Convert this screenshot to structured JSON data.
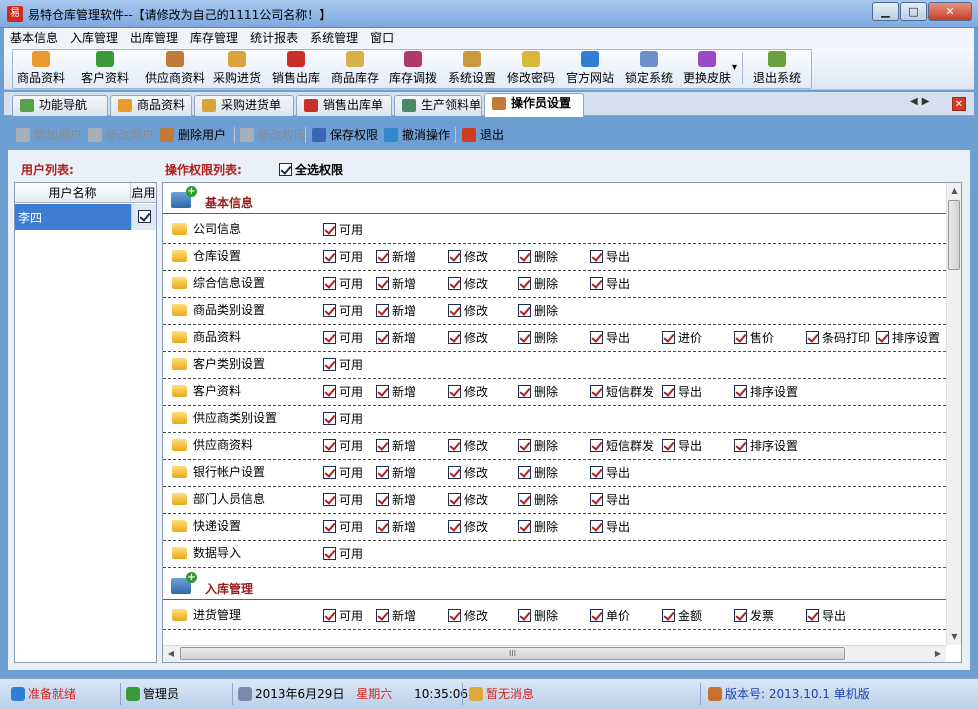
{
  "window": {
    "app_icon_text": "易",
    "title": "易特仓库管理软件--【请修改为自己的1111公司名称！】",
    "min_glyph": "▁",
    "max_glyph": "□",
    "close_glyph": "✕"
  },
  "menu": [
    "基本信息",
    "入库管理",
    "出库管理",
    "库存管理",
    "统计报表",
    "系统管理",
    "窗口"
  ],
  "toolbar": {
    "buttons": [
      {
        "label": "商品资料",
        "icon": "goods-icon",
        "color": "#e89a2c"
      },
      {
        "label": "客户资料",
        "icon": "customers-icon",
        "color": "#3a9a3a"
      },
      {
        "label": "供应商资料",
        "icon": "suppliers-icon",
        "color": "#c07b3a"
      },
      {
        "label": "采购进货",
        "icon": "purchase-truck-icon",
        "color": "#d9a43a"
      },
      {
        "label": "销售出库",
        "icon": "sales-out-icon",
        "color": "#c9302c"
      },
      {
        "label": "商品库存",
        "icon": "inventory-box-icon",
        "color": "#d8b04a"
      },
      {
        "label": "库存调拨",
        "icon": "transfer-icon",
        "color": "#b23a6a"
      },
      {
        "label": "系统设置",
        "icon": "system-settings-icon",
        "color": "#c99a3a"
      },
      {
        "label": "修改密码",
        "icon": "password-pencil-icon",
        "color": "#d7b83a"
      },
      {
        "label": "官方网站",
        "icon": "browser-icon",
        "color": "#2f7fd4"
      },
      {
        "label": "锁定系统",
        "icon": "lock-system-icon",
        "color": "#6a8fc9"
      },
      {
        "label": "更换皮肤",
        "icon": "skin-palette-icon",
        "color": "#9a4ac9"
      },
      {
        "label": "退出系统",
        "icon": "exit-door-icon",
        "color": "#6aa03a"
      }
    ],
    "more_glyph": "▾"
  },
  "tabs": [
    {
      "label": "功能导航",
      "icon": "navigation-icon",
      "color": "#5aa04a",
      "active": false
    },
    {
      "label": "商品资料",
      "icon": "goods-icon",
      "color": "#e89a2c",
      "active": false
    },
    {
      "label": "采购进货单",
      "icon": "purchase-truck-icon",
      "color": "#d9a43a",
      "active": false
    },
    {
      "label": "销售出库单",
      "icon": "sales-out-icon",
      "color": "#c9302c",
      "active": false
    },
    {
      "label": "生产领料单",
      "icon": "production-icon",
      "color": "#4a8a6a",
      "active": false
    },
    {
      "label": "操作员设置",
      "icon": "operators-icon",
      "color": "#c07b3a",
      "active": true
    }
  ],
  "tab_nav": {
    "prev": "◀",
    "next": "▶",
    "close_all": "✕"
  },
  "actions": [
    {
      "label": "增加用户",
      "icon": "add-user-icon",
      "enabled": false,
      "color": "#a9b0ba"
    },
    {
      "label": "修改用户",
      "icon": "edit-user-icon",
      "enabled": false,
      "color": "#a9b0ba"
    },
    {
      "label": "删除用户",
      "icon": "delete-user-icon",
      "enabled": true,
      "color": "#c07b3a"
    },
    {
      "label": "修改权限",
      "icon": "edit-permissions-icon",
      "enabled": false,
      "color": "#a9b0ba"
    },
    {
      "label": "保存权限",
      "icon": "save-icon",
      "enabled": true,
      "color": "#3a66b8"
    },
    {
      "label": "撤消操作",
      "icon": "undo-icon",
      "enabled": true,
      "color": "#2f88c9"
    },
    {
      "label": "退出",
      "icon": "exit-x-icon",
      "enabled": true,
      "color": "#d33a26"
    }
  ],
  "user_list": {
    "label": "用户列表:",
    "columns": [
      "用户名称",
      "启用"
    ],
    "rows": [
      {
        "name": "李四",
        "enabled": true
      }
    ]
  },
  "permissions": {
    "label": "操作权限列表:",
    "select_all_label": "全选权限",
    "select_all_checked": true,
    "sections": [
      {
        "title": "基本信息",
        "rows": [
          {
            "name": "公司信息",
            "options": [
              "可用"
            ]
          },
          {
            "name": "仓库设置",
            "options": [
              "可用",
              "新增",
              "修改",
              "删除",
              "导出"
            ]
          },
          {
            "name": "综合信息设置",
            "options": [
              "可用",
              "新增",
              "修改",
              "删除",
              "导出"
            ]
          },
          {
            "name": "商品类别设置",
            "options": [
              "可用",
              "新增",
              "修改",
              "删除"
            ]
          },
          {
            "name": "商品资料",
            "options": [
              "可用",
              "新增",
              "修改",
              "删除",
              "导出",
              "进价",
              "售价",
              "条码打印",
              "排序设置"
            ]
          },
          {
            "name": "客户类别设置",
            "options": [
              "可用"
            ]
          },
          {
            "name": "客户资料",
            "options": [
              "可用",
              "新增",
              "修改",
              "删除",
              "短信群发",
              "导出",
              "排序设置"
            ]
          },
          {
            "name": "供应商类别设置",
            "options": [
              "可用"
            ]
          },
          {
            "name": "供应商资料",
            "options": [
              "可用",
              "新增",
              "修改",
              "删除",
              "短信群发",
              "导出",
              "排序设置"
            ]
          },
          {
            "name": "银行帐户设置",
            "options": [
              "可用",
              "新增",
              "修改",
              "删除",
              "导出"
            ]
          },
          {
            "name": "部门人员信息",
            "options": [
              "可用",
              "新增",
              "修改",
              "删除",
              "导出"
            ]
          },
          {
            "name": "快递设置",
            "options": [
              "可用",
              "新增",
              "修改",
              "删除",
              "导出"
            ]
          },
          {
            "name": "数据导入",
            "options": [
              "可用"
            ]
          }
        ]
      },
      {
        "title": "入库管理",
        "rows": [
          {
            "name": "进货管理",
            "options": [
              "可用",
              "新增",
              "修改",
              "删除",
              "单价",
              "金额",
              "发票",
              "导出"
            ]
          }
        ]
      }
    ]
  },
  "scrollbar": {
    "up": "▲",
    "down": "▼",
    "left": "◀",
    "right": "▶",
    "grip": "III"
  },
  "status": {
    "ready": "准备就绪",
    "ready_color": "#d4261c",
    "user": "管理员",
    "date": "2013年6月29日",
    "weekday": "星期六",
    "weekday_color": "#d4261c",
    "time": "10:35:06",
    "message": "暂无消息",
    "message_color": "#d4261c",
    "version": "版本号: 2013.10.1 单机版",
    "version_color": "#1d3fb0"
  }
}
